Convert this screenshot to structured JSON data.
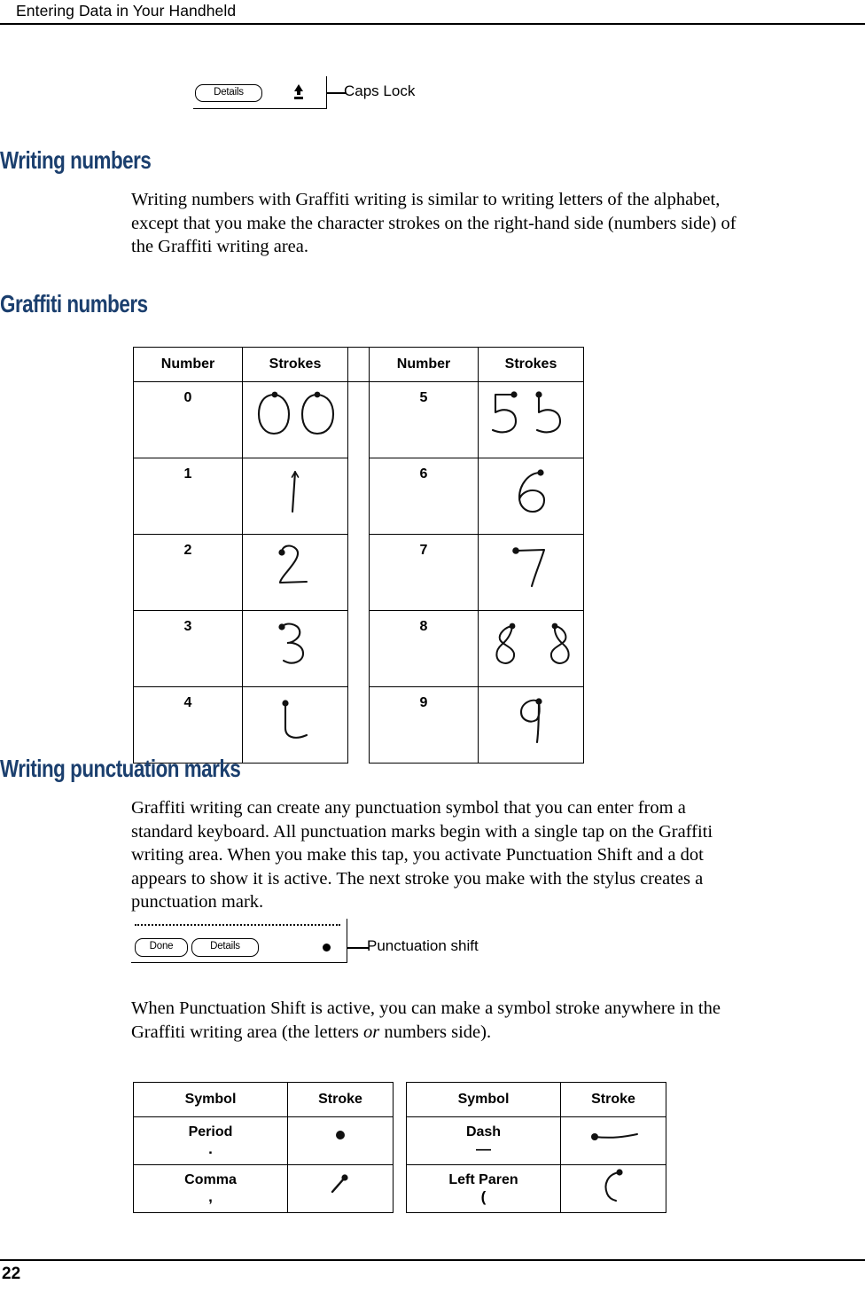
{
  "header": {
    "running_title": "Entering Data in Your Handheld"
  },
  "figures": {
    "caps_lock": {
      "button_details": "Details",
      "callout": "Caps Lock",
      "glyph": "caps-lock-arrow"
    },
    "punctuation_shift": {
      "button_done": "Done",
      "button_details": "Details",
      "callout": "Punctuation shift",
      "glyph": "punctuation-dot"
    }
  },
  "sections": {
    "writing_numbers": {
      "heading": "Writing numbers",
      "paragraph": "Writing numbers with Graffiti writing is similar to writing letters of the alphabet, except that you make the character strokes on the right-hand side (numbers side) of the Graffiti writing area."
    },
    "graffiti_numbers": {
      "heading": "Graffiti numbers"
    },
    "writing_punctuation": {
      "heading": "Writing punctuation marks",
      "paragraph": "Graffiti writing can create any punctuation symbol that you can enter from a standard keyboard. All punctuation marks begin with a single tap on the Graffiti writing area. When you make this tap, you activate Punctuation Shift and a dot appears to show it is active. The next stroke you make with the stylus creates a punctuation mark.",
      "paragraph_2_part1": "When Punctuation Shift is active, you can make a symbol stroke anywhere in the Graffiti writing area (the letters ",
      "paragraph_2_italic": "or",
      "paragraph_2_part2": " numbers side)."
    }
  },
  "numbers_table": {
    "columns": [
      "Number",
      "Strokes",
      "Number",
      "Strokes"
    ],
    "rows": [
      {
        "left_number": "0",
        "left_stroke": "zero-two-circles-stroke",
        "right_number": "5",
        "right_stroke": "five-two-variants-stroke"
      },
      {
        "left_number": "1",
        "left_stroke": "one-vertical-stroke",
        "right_number": "6",
        "right_stroke": "six-stroke"
      },
      {
        "left_number": "2",
        "left_stroke": "two-stroke",
        "right_number": "7",
        "right_stroke": "seven-stroke"
      },
      {
        "left_number": "3",
        "left_stroke": "three-stroke",
        "right_number": "8",
        "right_stroke": "eight-two-variants-stroke"
      },
      {
        "left_number": "4",
        "left_stroke": "four-stroke",
        "right_number": "9",
        "right_stroke": "nine-stroke"
      }
    ]
  },
  "punctuation_table_left": {
    "columns": [
      "Symbol",
      "Stroke"
    ],
    "rows": [
      {
        "name": "Period",
        "glyph": ".",
        "stroke": "period-dot-stroke"
      },
      {
        "name": "Comma",
        "glyph": ",",
        "stroke": "comma-diagonal-stroke"
      }
    ]
  },
  "punctuation_table_right": {
    "columns": [
      "Symbol",
      "Stroke"
    ],
    "rows": [
      {
        "name": "Dash",
        "glyph": "—",
        "stroke": "dash-horizontal-stroke"
      },
      {
        "name": "Left Paren",
        "glyph": "(",
        "stroke": "left-paren-curve-stroke"
      }
    ]
  },
  "footer": {
    "page_number": "22"
  },
  "colors": {
    "heading": "#1b3f6e",
    "text": "#000000",
    "background": "#ffffff"
  }
}
